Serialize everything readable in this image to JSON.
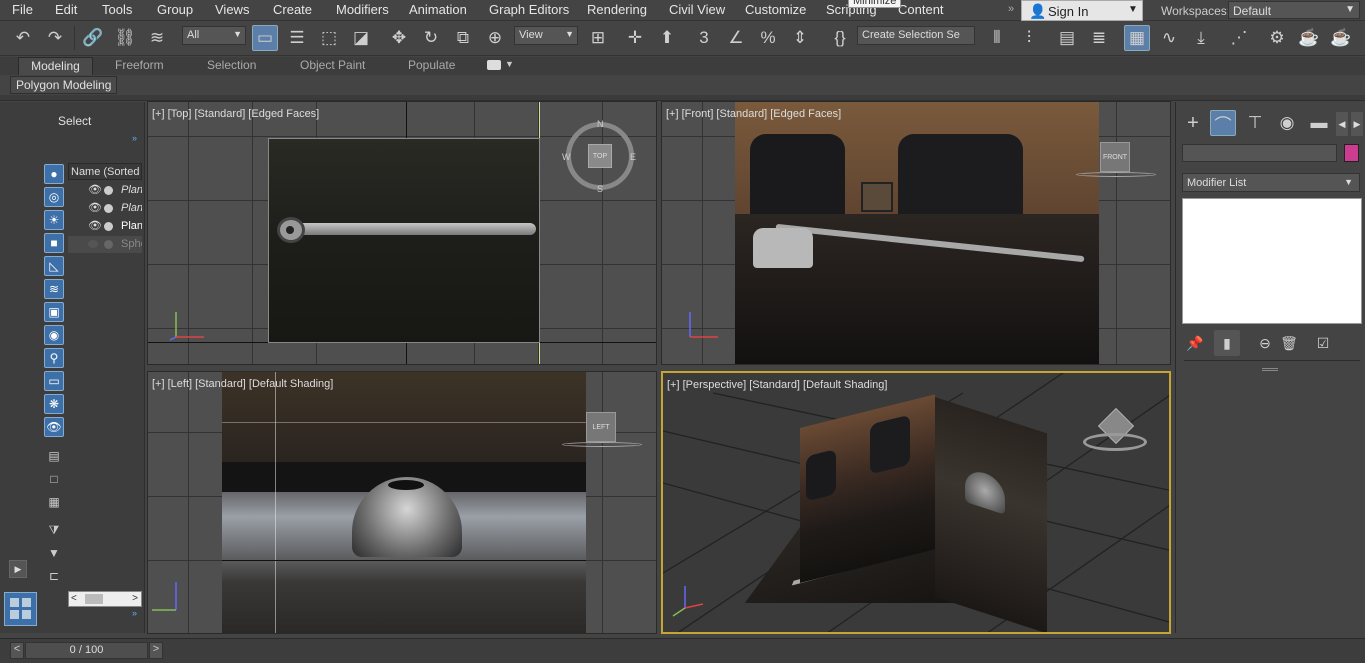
{
  "menubar": {
    "items": [
      "File",
      "Edit",
      "Tools",
      "Group",
      "Views",
      "Create",
      "Modifiers",
      "Animation",
      "Graph Editors",
      "Rendering",
      "Civil View",
      "Customize",
      "Scripting",
      "Content"
    ],
    "tooltip": "Minimize",
    "sign_in": "Sign In",
    "workspaces_label": "Workspaces:",
    "workspace_value": "Default"
  },
  "toolbar": {
    "filter_value": "All",
    "ref_coord_value": "View",
    "selection_set_value": "Create Selection Se"
  },
  "ribbon": {
    "tabs": [
      "Modeling",
      "Freeform",
      "Selection",
      "Object Paint",
      "Populate"
    ],
    "active_tab": "Modeling",
    "sub_label": "Polygon Modeling"
  },
  "scene_explorer": {
    "select_label": "Select",
    "column_header": "Name (Sorted A",
    "rows": [
      {
        "name": "Plan",
        "visible": true
      },
      {
        "name": "Plan",
        "visible": true
      },
      {
        "name": "Plan",
        "visible": true
      },
      {
        "name": "Sphe",
        "visible": false
      }
    ]
  },
  "viewports": {
    "top": {
      "label": "[+] [Top] [Standard] [Edged Faces]",
      "cube": "TOP",
      "compass": [
        "N",
        "S",
        "E",
        "W"
      ]
    },
    "front": {
      "label": "[+] [Front] [Standard] [Edged Faces]",
      "cube": "FRONT"
    },
    "left": {
      "label": "[+] [Left] [Standard] [Default Shading]",
      "cube": "LEFT"
    },
    "perspective": {
      "label": "[+] [Perspective] [Standard] [Default Shading]"
    }
  },
  "command_panel": {
    "modifier_list": "Modifier List",
    "color_swatch": "#cc3d8f"
  },
  "status": {
    "timeline": "0 / 100"
  },
  "colors": {
    "accent": "#5b7fa8",
    "active_viewport_border": "#c8a432"
  }
}
